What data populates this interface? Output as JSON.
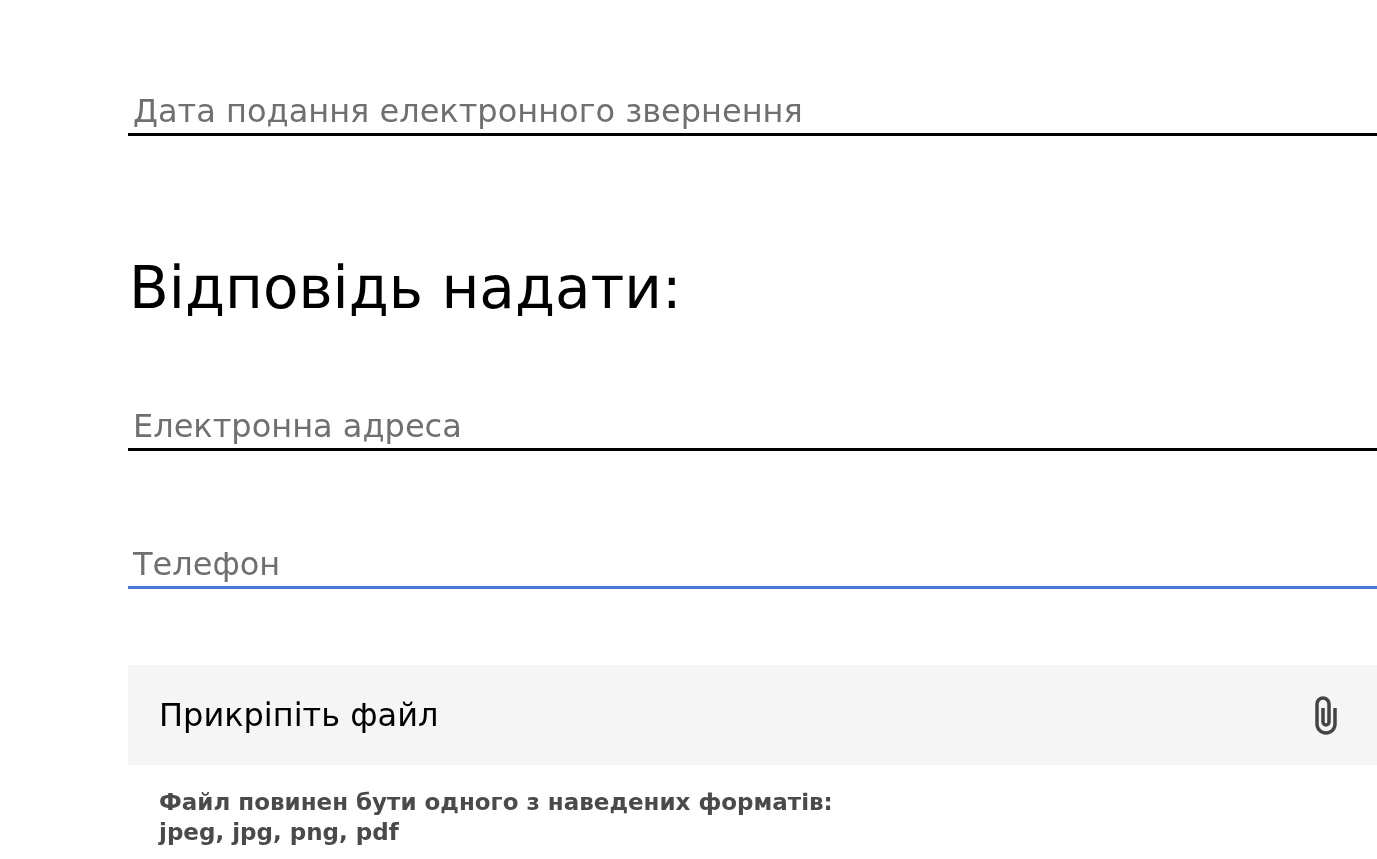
{
  "submission_date_field": {
    "placeholder": "Дата подання електронного звернення",
    "focused": false
  },
  "reply_section": {
    "heading": "Відповідь надати:",
    "fields": [
      {
        "placeholder": "Електронна адреса",
        "focused": false
      },
      {
        "placeholder": "Телефон",
        "focused": true
      }
    ]
  },
  "attachment": {
    "label": "Прикріпіть файл",
    "hint": "Файл повинен бути одного з наведених форматів:",
    "formats": "jpeg, jpg, png, pdf"
  }
}
